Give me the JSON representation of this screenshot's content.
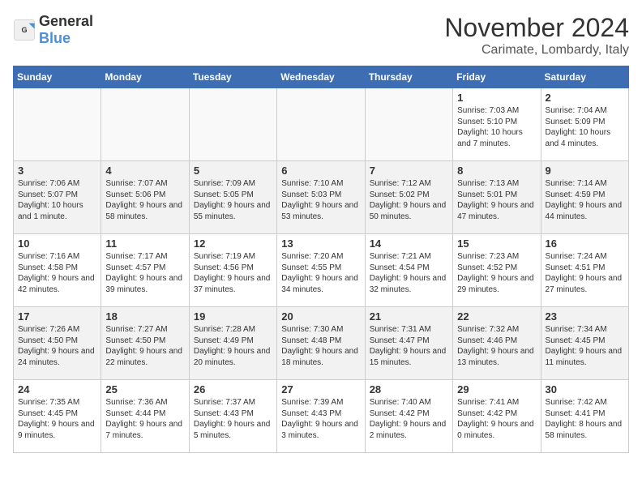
{
  "header": {
    "logo_general": "General",
    "logo_blue": "Blue",
    "month": "November 2024",
    "location": "Carimate, Lombardy, Italy"
  },
  "weekdays": [
    "Sunday",
    "Monday",
    "Tuesday",
    "Wednesday",
    "Thursday",
    "Friday",
    "Saturday"
  ],
  "weeks": [
    [
      {
        "day": "",
        "info": ""
      },
      {
        "day": "",
        "info": ""
      },
      {
        "day": "",
        "info": ""
      },
      {
        "day": "",
        "info": ""
      },
      {
        "day": "",
        "info": ""
      },
      {
        "day": "1",
        "info": "Sunrise: 7:03 AM\nSunset: 5:10 PM\nDaylight: 10 hours and 7 minutes."
      },
      {
        "day": "2",
        "info": "Sunrise: 7:04 AM\nSunset: 5:09 PM\nDaylight: 10 hours and 4 minutes."
      }
    ],
    [
      {
        "day": "3",
        "info": "Sunrise: 7:06 AM\nSunset: 5:07 PM\nDaylight: 10 hours and 1 minute."
      },
      {
        "day": "4",
        "info": "Sunrise: 7:07 AM\nSunset: 5:06 PM\nDaylight: 9 hours and 58 minutes."
      },
      {
        "day": "5",
        "info": "Sunrise: 7:09 AM\nSunset: 5:05 PM\nDaylight: 9 hours and 55 minutes."
      },
      {
        "day": "6",
        "info": "Sunrise: 7:10 AM\nSunset: 5:03 PM\nDaylight: 9 hours and 53 minutes."
      },
      {
        "day": "7",
        "info": "Sunrise: 7:12 AM\nSunset: 5:02 PM\nDaylight: 9 hours and 50 minutes."
      },
      {
        "day": "8",
        "info": "Sunrise: 7:13 AM\nSunset: 5:01 PM\nDaylight: 9 hours and 47 minutes."
      },
      {
        "day": "9",
        "info": "Sunrise: 7:14 AM\nSunset: 4:59 PM\nDaylight: 9 hours and 44 minutes."
      }
    ],
    [
      {
        "day": "10",
        "info": "Sunrise: 7:16 AM\nSunset: 4:58 PM\nDaylight: 9 hours and 42 minutes."
      },
      {
        "day": "11",
        "info": "Sunrise: 7:17 AM\nSunset: 4:57 PM\nDaylight: 9 hours and 39 minutes."
      },
      {
        "day": "12",
        "info": "Sunrise: 7:19 AM\nSunset: 4:56 PM\nDaylight: 9 hours and 37 minutes."
      },
      {
        "day": "13",
        "info": "Sunrise: 7:20 AM\nSunset: 4:55 PM\nDaylight: 9 hours and 34 minutes."
      },
      {
        "day": "14",
        "info": "Sunrise: 7:21 AM\nSunset: 4:54 PM\nDaylight: 9 hours and 32 minutes."
      },
      {
        "day": "15",
        "info": "Sunrise: 7:23 AM\nSunset: 4:52 PM\nDaylight: 9 hours and 29 minutes."
      },
      {
        "day": "16",
        "info": "Sunrise: 7:24 AM\nSunset: 4:51 PM\nDaylight: 9 hours and 27 minutes."
      }
    ],
    [
      {
        "day": "17",
        "info": "Sunrise: 7:26 AM\nSunset: 4:50 PM\nDaylight: 9 hours and 24 minutes."
      },
      {
        "day": "18",
        "info": "Sunrise: 7:27 AM\nSunset: 4:50 PM\nDaylight: 9 hours and 22 minutes."
      },
      {
        "day": "19",
        "info": "Sunrise: 7:28 AM\nSunset: 4:49 PM\nDaylight: 9 hours and 20 minutes."
      },
      {
        "day": "20",
        "info": "Sunrise: 7:30 AM\nSunset: 4:48 PM\nDaylight: 9 hours and 18 minutes."
      },
      {
        "day": "21",
        "info": "Sunrise: 7:31 AM\nSunset: 4:47 PM\nDaylight: 9 hours and 15 minutes."
      },
      {
        "day": "22",
        "info": "Sunrise: 7:32 AM\nSunset: 4:46 PM\nDaylight: 9 hours and 13 minutes."
      },
      {
        "day": "23",
        "info": "Sunrise: 7:34 AM\nSunset: 4:45 PM\nDaylight: 9 hours and 11 minutes."
      }
    ],
    [
      {
        "day": "24",
        "info": "Sunrise: 7:35 AM\nSunset: 4:45 PM\nDaylight: 9 hours and 9 minutes."
      },
      {
        "day": "25",
        "info": "Sunrise: 7:36 AM\nSunset: 4:44 PM\nDaylight: 9 hours and 7 minutes."
      },
      {
        "day": "26",
        "info": "Sunrise: 7:37 AM\nSunset: 4:43 PM\nDaylight: 9 hours and 5 minutes."
      },
      {
        "day": "27",
        "info": "Sunrise: 7:39 AM\nSunset: 4:43 PM\nDaylight: 9 hours and 3 minutes."
      },
      {
        "day": "28",
        "info": "Sunrise: 7:40 AM\nSunset: 4:42 PM\nDaylight: 9 hours and 2 minutes."
      },
      {
        "day": "29",
        "info": "Sunrise: 7:41 AM\nSunset: 4:42 PM\nDaylight: 9 hours and 0 minutes."
      },
      {
        "day": "30",
        "info": "Sunrise: 7:42 AM\nSunset: 4:41 PM\nDaylight: 8 hours and 58 minutes."
      }
    ]
  ]
}
